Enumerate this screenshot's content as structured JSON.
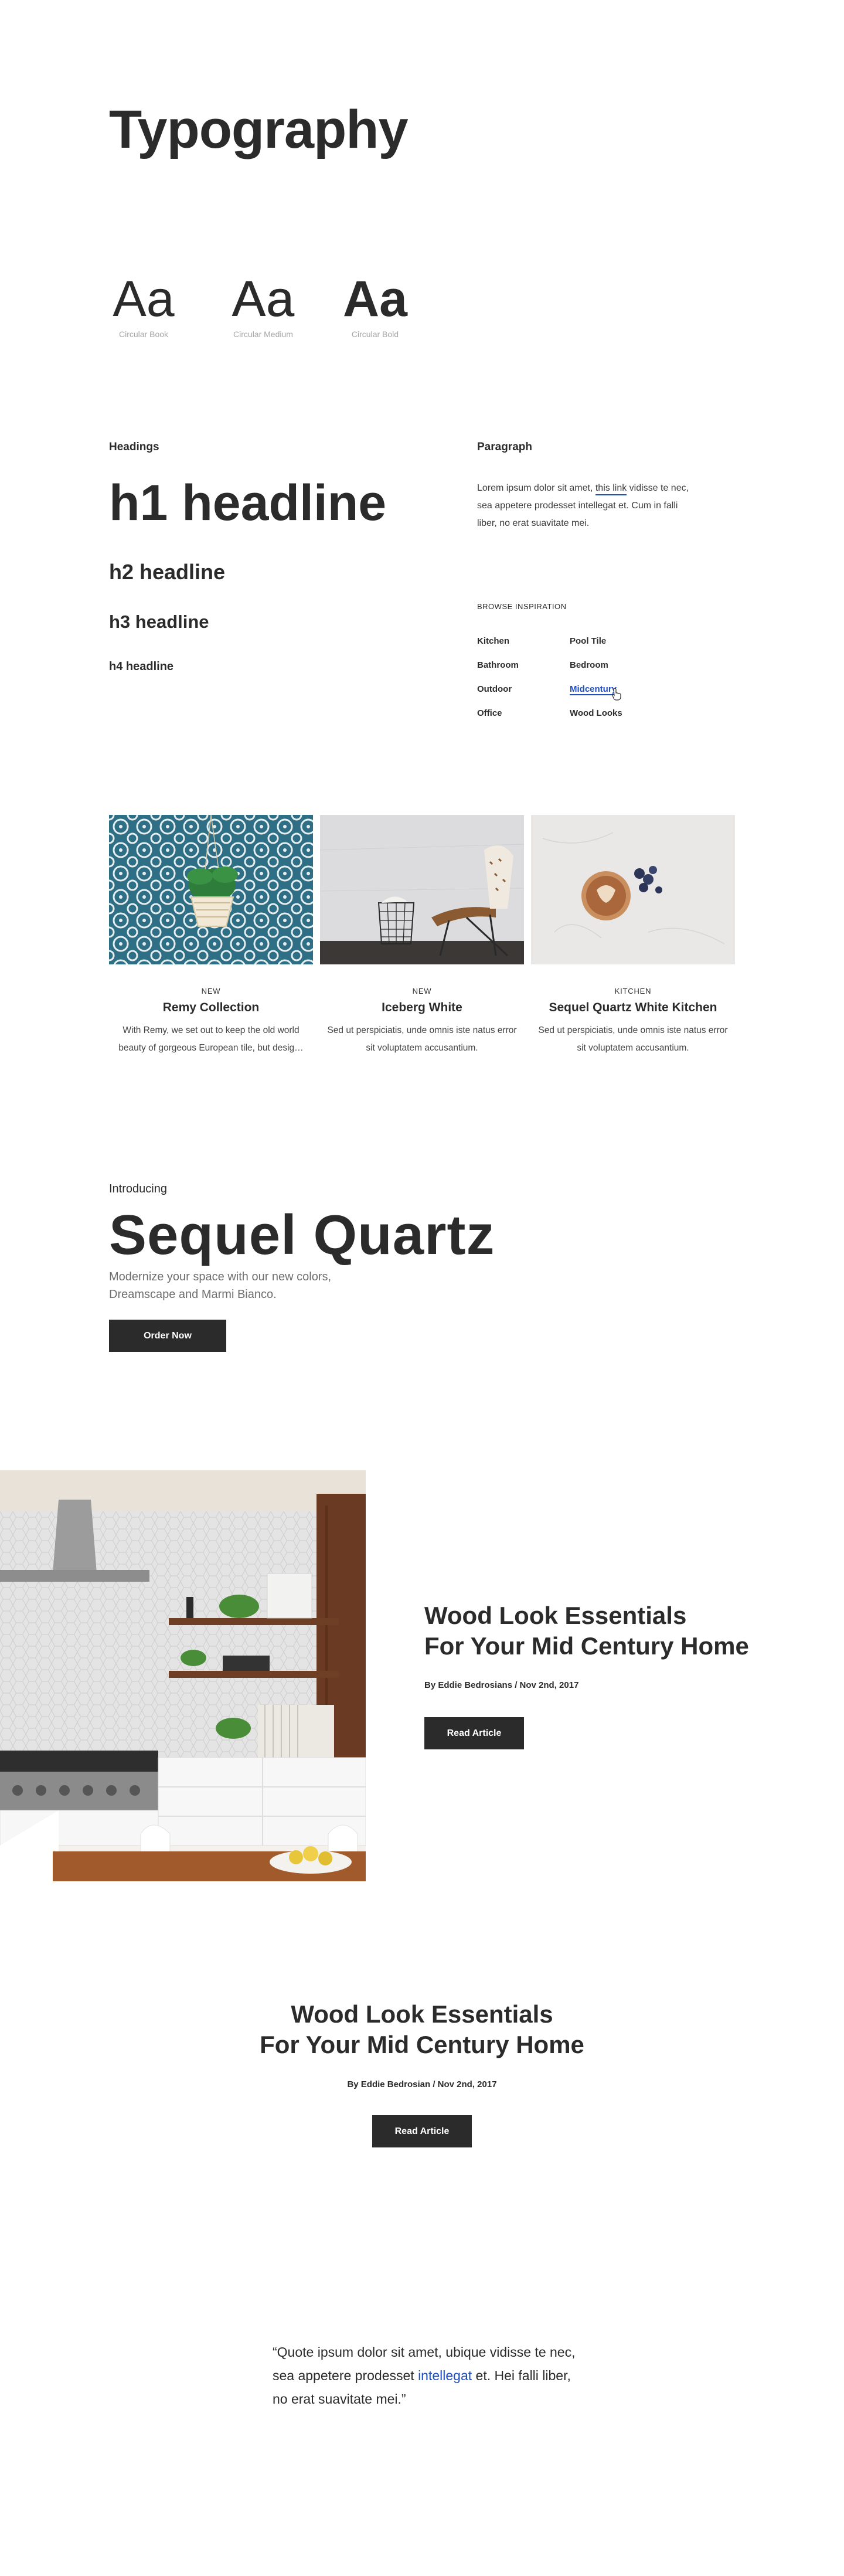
{
  "page": {
    "title": "Typography"
  },
  "fonts": [
    {
      "sample": "Aa",
      "name": "Circular Book"
    },
    {
      "sample": "Aa",
      "name": "Circular Medium"
    },
    {
      "sample": "Aa",
      "name": "Circular Bold"
    }
  ],
  "headings": {
    "label": "Headings",
    "h1": "h1 headline",
    "h2": "h2 headline",
    "h3": "h3 headline",
    "h4": "h4 headline"
  },
  "paragraph": {
    "label": "Paragraph",
    "text_before": "Lorem ipsum dolor sit amet, ",
    "link": "this link",
    "text_after": " vidisse te nec, sea appetere prodesset intellegat et. Cum in falli liber, no erat suavitate mei."
  },
  "browse": {
    "label": "BROWSE INSPIRATION",
    "items": [
      "Kitchen",
      "Pool Tile",
      "Bathroom",
      "Bedroom",
      "Outdoor",
      "Midcentury",
      "Office",
      "Wood Looks"
    ],
    "active": "Midcentury"
  },
  "cards": [
    {
      "tag": "NEW",
      "title": "Remy Collection",
      "desc": "With Remy, we set out to keep the old world beauty of gorgeous European tile, but desig…"
    },
    {
      "tag": "NEW",
      "title": "Iceberg White",
      "desc": "Sed ut perspiciatis, unde omnis iste natus error sit voluptatem accusantium."
    },
    {
      "tag": "KITCHEN",
      "title": "Sequel Quartz White Kitchen",
      "desc": "Sed ut perspiciatis, unde omnis iste natus error sit voluptatem accusantium."
    }
  ],
  "promo": {
    "intro": "Introducing",
    "title": "Sequel Quartz",
    "subtitle": "Modernize your space with our new colors, Dreamscape and Marmi Bianco.",
    "button": "Order Now"
  },
  "feature": {
    "title_line1": "Wood Look Essentials",
    "title_line2": "For Your Mid Century Home",
    "byline": "By Eddie Bedrosians / Nov 2nd, 2017",
    "button": "Read Article"
  },
  "article": {
    "title_line1": "Wood Look Essentials",
    "title_line2": "For Your Mid Century Home",
    "byline": "By Eddie Bedrosian / Nov 2nd, 2017",
    "button": "Read Article"
  },
  "quote": {
    "before": "“Quote ipsum dolor sit amet, ubique vidisse te nec, sea appetere prodesset ",
    "link": "intellegat",
    "after": " et. Hei falli liber, no erat suavitate mei.”"
  },
  "colors": {
    "text": "#2b2b2c",
    "link": "#1f4fbf",
    "caption": "#a5a5a5",
    "button": "#2b2b2c"
  }
}
